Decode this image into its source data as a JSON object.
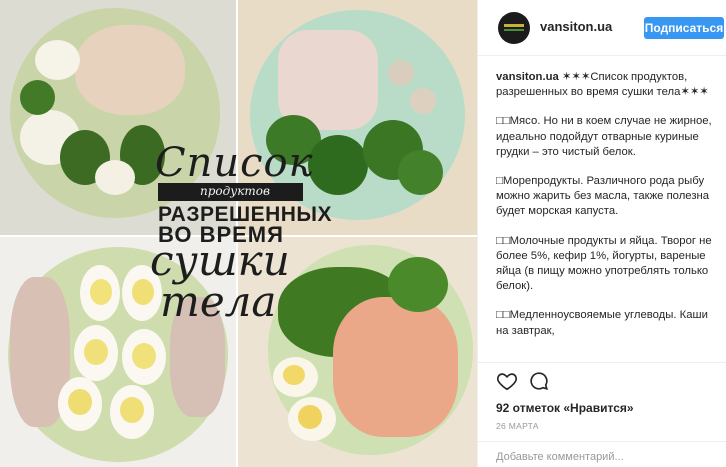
{
  "photo": {
    "overlay": {
      "line1": "Список",
      "line2": "продуктов",
      "line3": "РАЗРЕШЕННЫХ",
      "line4": "ВО ВРЕМЯ",
      "line5": "сушки",
      "line6": "тела"
    }
  },
  "header": {
    "username": "vansiton.ua",
    "follow_label": "Подписаться",
    "accent_color": "#3897f0"
  },
  "caption": {
    "paragraphs": [
      {
        "user": "vansiton.ua",
        "text": " ✶✶✶Список продуктов, разрешенных во время сушки тела✶✶✶"
      },
      {
        "user": "",
        "text": "□□Мясо. Но ни в коем случае не жирное, идеально подойдут отварные куриные грудки – это чистый белок."
      },
      {
        "user": "",
        "text": "□Морепродукты. Различного рода рыбу можно жарить без масла, также полезна будет морская капуста."
      },
      {
        "user": "",
        "text": "□□Молочные продукты и яйца. Творог не более 5%, кефир 1%, йогурты, вареные яйца (в пищу можно употреблять только белок)."
      },
      {
        "user": "",
        "text": "□□Медленноусвояемые углеводы. Каши на завтрак,"
      }
    ]
  },
  "actions": {
    "heart_icon": "heart-outline-icon",
    "comment_icon": "comment-bubble-icon",
    "likes": "92 отметок «Нравится»",
    "date": "26 МАРТА",
    "add_comment_placeholder": "Добавьте комментарий..."
  }
}
